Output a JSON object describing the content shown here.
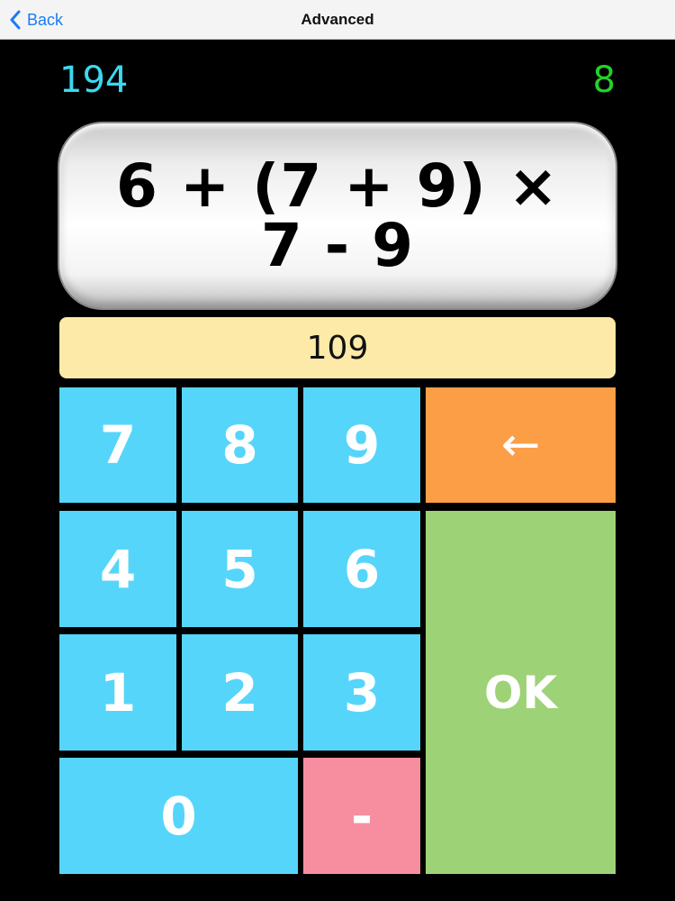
{
  "navbar": {
    "back_label": "Back",
    "title": "Advanced"
  },
  "stats": {
    "score": "194",
    "count": "8"
  },
  "problem": {
    "expression": "6 + (7 + 9) × 7 - 9"
  },
  "answer": {
    "value": "109"
  },
  "keypad": {
    "k7": "7",
    "k8": "8",
    "k9": "9",
    "backspace": "←",
    "k4": "4",
    "k5": "5",
    "k6": "6",
    "ok": "OK",
    "k1": "1",
    "k2": "2",
    "k3": "3",
    "k0": "0",
    "minus": "-"
  },
  "colors": {
    "score": "#3ad9f0",
    "count": "#23d12a",
    "answer_bg": "#fdeaa8",
    "digit_key": "#56d5fa",
    "backspace_key": "#fb9e46",
    "ok_key": "#9ed276",
    "minus_key": "#f78ea0",
    "nav_link": "#1a7cf5"
  },
  "icons": {
    "back": "chevron-left-icon"
  }
}
